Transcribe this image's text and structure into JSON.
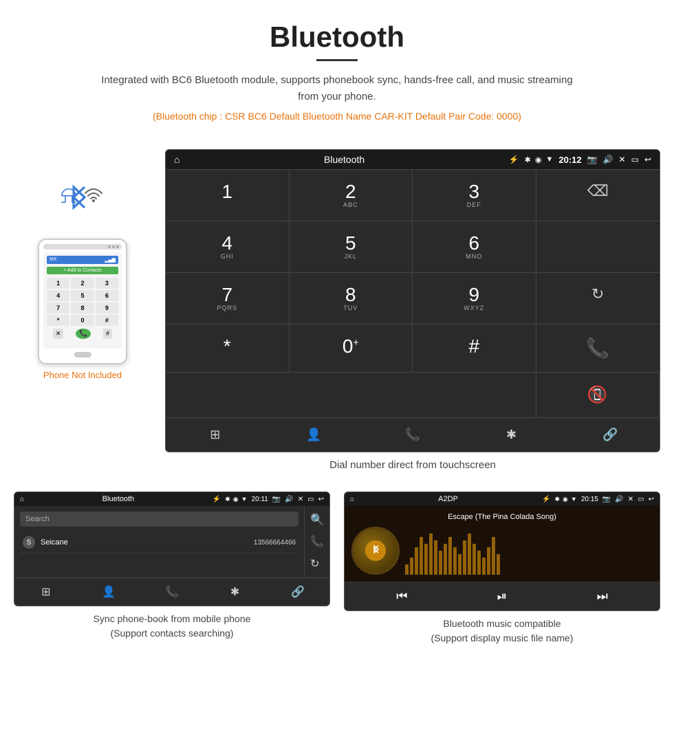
{
  "header": {
    "title": "Bluetooth",
    "description": "Integrated with BC6 Bluetooth module, supports phonebook sync, hands-free call, and music streaming from your phone.",
    "specs": "(Bluetooth chip : CSR BC6    Default Bluetooth Name CAR-KIT    Default Pair Code: 0000)"
  },
  "phone": {
    "not_included_label": "Phone Not Included",
    "status": "MX",
    "add_contacts": "+ Add to Contacts",
    "dialpad_keys": [
      "1",
      "2",
      "3",
      "4",
      "5",
      "6",
      "7",
      "8",
      "9",
      "*",
      "0",
      "#"
    ]
  },
  "dial_screen": {
    "title": "Bluetooth",
    "time": "20:12",
    "charge_icon": "⚡",
    "keys": [
      {
        "num": "1",
        "sub": ""
      },
      {
        "num": "2",
        "sub": "ABC"
      },
      {
        "num": "3",
        "sub": "DEF"
      },
      {
        "num": "",
        "sub": ""
      },
      {
        "num": "4",
        "sub": "GHI"
      },
      {
        "num": "5",
        "sub": "JKL"
      },
      {
        "num": "6",
        "sub": "MNO"
      },
      {
        "num": "",
        "sub": ""
      },
      {
        "num": "7",
        "sub": "PQRS"
      },
      {
        "num": "8",
        "sub": "TUV"
      },
      {
        "num": "9",
        "sub": "WXYZ"
      },
      {
        "num": "",
        "sub": "refresh"
      },
      {
        "num": "*",
        "sub": ""
      },
      {
        "num": "0",
        "sub": "+"
      },
      {
        "num": "#",
        "sub": ""
      },
      {
        "num": "",
        "sub": ""
      }
    ],
    "footer_icons": [
      "⊞",
      "👤",
      "📞",
      "✱",
      "🔗"
    ]
  },
  "dial_caption": "Dial number direct from touchscreen",
  "phonebook_screen": {
    "title": "Bluetooth",
    "time": "20:11",
    "search_placeholder": "Search",
    "contacts": [
      {
        "initial": "S",
        "name": "Seicane",
        "number": "13566664466"
      }
    ],
    "side_icons": [
      "🔍",
      "📞",
      "🔄"
    ],
    "footer_icons": [
      "⊞",
      "👤",
      "📞",
      "✱",
      "🔗"
    ]
  },
  "phonebook_caption": {
    "line1": "Sync phone-book from mobile phone",
    "line2": "(Support contacts searching)"
  },
  "music_screen": {
    "title": "A2DP",
    "time": "20:15",
    "song_title": "Escape (The Pina Colada Song)",
    "viz_heights": [
      15,
      25,
      40,
      55,
      45,
      60,
      50,
      35,
      45,
      55,
      40,
      30,
      50,
      60,
      45,
      35,
      25,
      40,
      55,
      30
    ],
    "controls": [
      "⏮",
      "⏯",
      "⏭"
    ]
  },
  "music_caption": {
    "line1": "Bluetooth music compatible",
    "line2": "(Support display music file name)"
  }
}
